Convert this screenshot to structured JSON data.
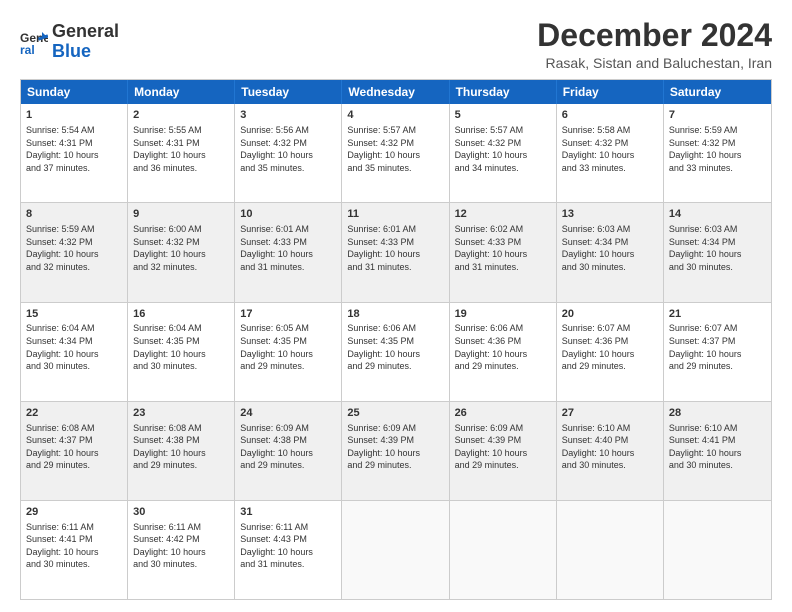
{
  "logo": {
    "line1": "General",
    "line2": "Blue"
  },
  "title": "December 2024",
  "location": "Rasak, Sistan and Baluchestan, Iran",
  "header_days": [
    "Sunday",
    "Monday",
    "Tuesday",
    "Wednesday",
    "Thursday",
    "Friday",
    "Saturday"
  ],
  "rows": [
    [
      {
        "day": "1",
        "lines": [
          "Sunrise: 5:54 AM",
          "Sunset: 4:31 PM",
          "Daylight: 10 hours",
          "and 37 minutes."
        ]
      },
      {
        "day": "2",
        "lines": [
          "Sunrise: 5:55 AM",
          "Sunset: 4:31 PM",
          "Daylight: 10 hours",
          "and 36 minutes."
        ]
      },
      {
        "day": "3",
        "lines": [
          "Sunrise: 5:56 AM",
          "Sunset: 4:32 PM",
          "Daylight: 10 hours",
          "and 35 minutes."
        ]
      },
      {
        "day": "4",
        "lines": [
          "Sunrise: 5:57 AM",
          "Sunset: 4:32 PM",
          "Daylight: 10 hours",
          "and 35 minutes."
        ]
      },
      {
        "day": "5",
        "lines": [
          "Sunrise: 5:57 AM",
          "Sunset: 4:32 PM",
          "Daylight: 10 hours",
          "and 34 minutes."
        ]
      },
      {
        "day": "6",
        "lines": [
          "Sunrise: 5:58 AM",
          "Sunset: 4:32 PM",
          "Daylight: 10 hours",
          "and 33 minutes."
        ]
      },
      {
        "day": "7",
        "lines": [
          "Sunrise: 5:59 AM",
          "Sunset: 4:32 PM",
          "Daylight: 10 hours",
          "and 33 minutes."
        ]
      }
    ],
    [
      {
        "day": "8",
        "lines": [
          "Sunrise: 5:59 AM",
          "Sunset: 4:32 PM",
          "Daylight: 10 hours",
          "and 32 minutes."
        ]
      },
      {
        "day": "9",
        "lines": [
          "Sunrise: 6:00 AM",
          "Sunset: 4:32 PM",
          "Daylight: 10 hours",
          "and 32 minutes."
        ]
      },
      {
        "day": "10",
        "lines": [
          "Sunrise: 6:01 AM",
          "Sunset: 4:33 PM",
          "Daylight: 10 hours",
          "and 31 minutes."
        ]
      },
      {
        "day": "11",
        "lines": [
          "Sunrise: 6:01 AM",
          "Sunset: 4:33 PM",
          "Daylight: 10 hours",
          "and 31 minutes."
        ]
      },
      {
        "day": "12",
        "lines": [
          "Sunrise: 6:02 AM",
          "Sunset: 4:33 PM",
          "Daylight: 10 hours",
          "and 31 minutes."
        ]
      },
      {
        "day": "13",
        "lines": [
          "Sunrise: 6:03 AM",
          "Sunset: 4:34 PM",
          "Daylight: 10 hours",
          "and 30 minutes."
        ]
      },
      {
        "day": "14",
        "lines": [
          "Sunrise: 6:03 AM",
          "Sunset: 4:34 PM",
          "Daylight: 10 hours",
          "and 30 minutes."
        ]
      }
    ],
    [
      {
        "day": "15",
        "lines": [
          "Sunrise: 6:04 AM",
          "Sunset: 4:34 PM",
          "Daylight: 10 hours",
          "and 30 minutes."
        ]
      },
      {
        "day": "16",
        "lines": [
          "Sunrise: 6:04 AM",
          "Sunset: 4:35 PM",
          "Daylight: 10 hours",
          "and 30 minutes."
        ]
      },
      {
        "day": "17",
        "lines": [
          "Sunrise: 6:05 AM",
          "Sunset: 4:35 PM",
          "Daylight: 10 hours",
          "and 29 minutes."
        ]
      },
      {
        "day": "18",
        "lines": [
          "Sunrise: 6:06 AM",
          "Sunset: 4:35 PM",
          "Daylight: 10 hours",
          "and 29 minutes."
        ]
      },
      {
        "day": "19",
        "lines": [
          "Sunrise: 6:06 AM",
          "Sunset: 4:36 PM",
          "Daylight: 10 hours",
          "and 29 minutes."
        ]
      },
      {
        "day": "20",
        "lines": [
          "Sunrise: 6:07 AM",
          "Sunset: 4:36 PM",
          "Daylight: 10 hours",
          "and 29 minutes."
        ]
      },
      {
        "day": "21",
        "lines": [
          "Sunrise: 6:07 AM",
          "Sunset: 4:37 PM",
          "Daylight: 10 hours",
          "and 29 minutes."
        ]
      }
    ],
    [
      {
        "day": "22",
        "lines": [
          "Sunrise: 6:08 AM",
          "Sunset: 4:37 PM",
          "Daylight: 10 hours",
          "and 29 minutes."
        ]
      },
      {
        "day": "23",
        "lines": [
          "Sunrise: 6:08 AM",
          "Sunset: 4:38 PM",
          "Daylight: 10 hours",
          "and 29 minutes."
        ]
      },
      {
        "day": "24",
        "lines": [
          "Sunrise: 6:09 AM",
          "Sunset: 4:38 PM",
          "Daylight: 10 hours",
          "and 29 minutes."
        ]
      },
      {
        "day": "25",
        "lines": [
          "Sunrise: 6:09 AM",
          "Sunset: 4:39 PM",
          "Daylight: 10 hours",
          "and 29 minutes."
        ]
      },
      {
        "day": "26",
        "lines": [
          "Sunrise: 6:09 AM",
          "Sunset: 4:39 PM",
          "Daylight: 10 hours",
          "and 29 minutes."
        ]
      },
      {
        "day": "27",
        "lines": [
          "Sunrise: 6:10 AM",
          "Sunset: 4:40 PM",
          "Daylight: 10 hours",
          "and 30 minutes."
        ]
      },
      {
        "day": "28",
        "lines": [
          "Sunrise: 6:10 AM",
          "Sunset: 4:41 PM",
          "Daylight: 10 hours",
          "and 30 minutes."
        ]
      }
    ],
    [
      {
        "day": "29",
        "lines": [
          "Sunrise: 6:11 AM",
          "Sunset: 4:41 PM",
          "Daylight: 10 hours",
          "and 30 minutes."
        ]
      },
      {
        "day": "30",
        "lines": [
          "Sunrise: 6:11 AM",
          "Sunset: 4:42 PM",
          "Daylight: 10 hours",
          "and 30 minutes."
        ]
      },
      {
        "day": "31",
        "lines": [
          "Sunrise: 6:11 AM",
          "Sunset: 4:43 PM",
          "Daylight: 10 hours",
          "and 31 minutes."
        ]
      },
      {
        "day": "",
        "lines": []
      },
      {
        "day": "",
        "lines": []
      },
      {
        "day": "",
        "lines": []
      },
      {
        "day": "",
        "lines": []
      }
    ]
  ]
}
